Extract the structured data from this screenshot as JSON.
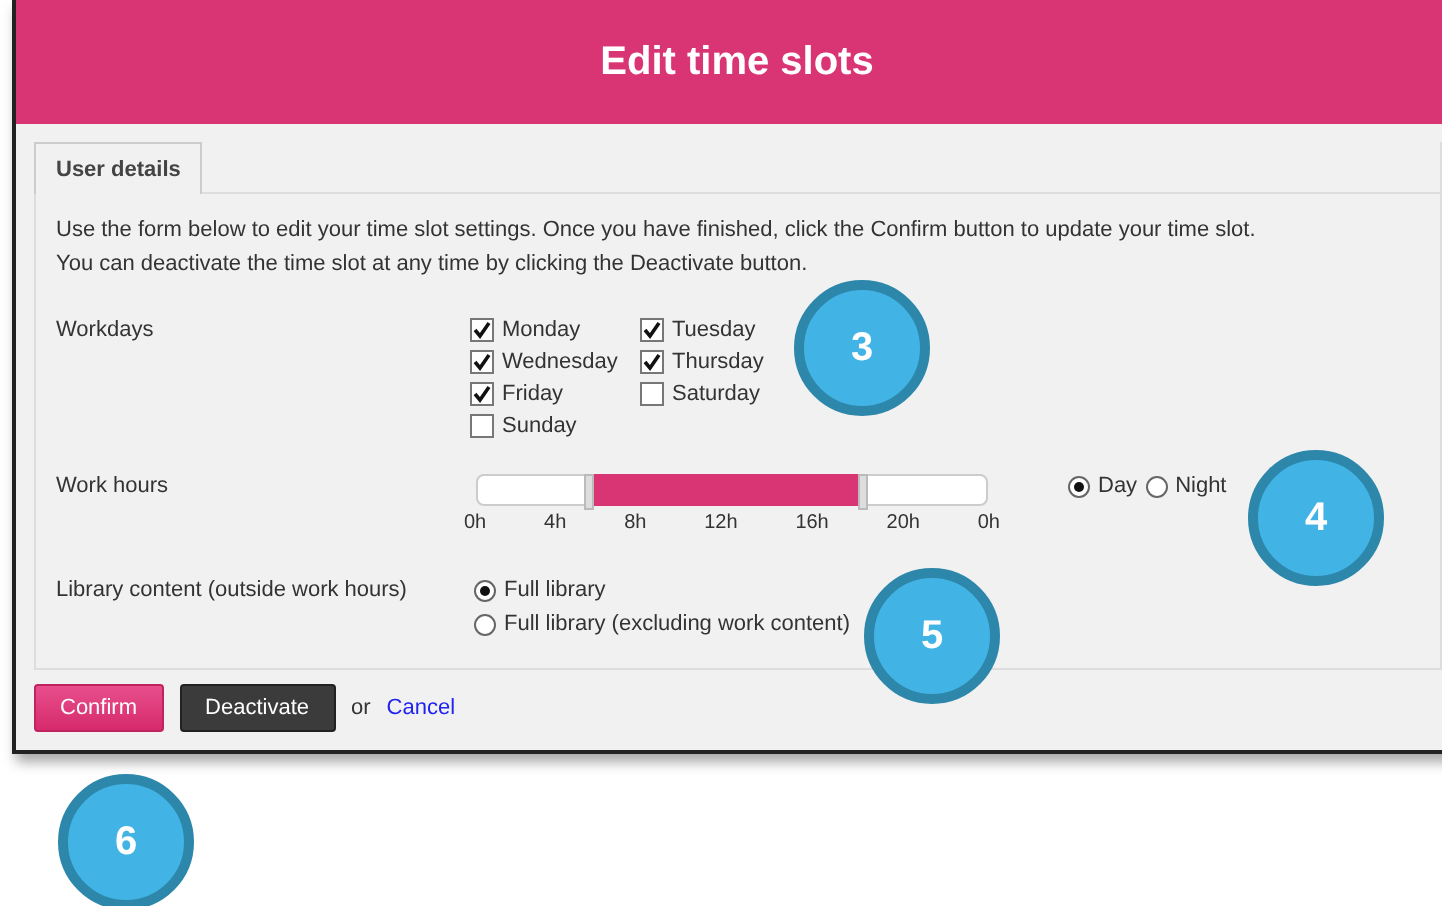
{
  "window": {
    "title": "Edit time slots"
  },
  "section": {
    "legend": "User details",
    "intro": "Use the form below to edit your time slot settings. Once you have finished, click the Confirm button to update your time slot. You can deactivate the time slot at any time by clicking the Deactivate button."
  },
  "workdays": {
    "label": "Workdays",
    "days": [
      {
        "label": "Monday",
        "checked": true
      },
      {
        "label": "Tuesday",
        "checked": true
      },
      {
        "label": "Wednesday",
        "checked": true
      },
      {
        "label": "Thursday",
        "checked": true
      },
      {
        "label": "Friday",
        "checked": true
      },
      {
        "label": "Saturday",
        "checked": false
      },
      {
        "label": "Sunday",
        "checked": false
      }
    ]
  },
  "work_hours": {
    "label": "Work hours",
    "handles": [
      {
        "level": 0.215
      },
      {
        "level": 0.755
      }
    ],
    "ticks": [
      "0h",
      "4h",
      "8h",
      "12h",
      "16h",
      "20h",
      "0h"
    ],
    "modes": [
      {
        "label": "Day",
        "selected": true
      },
      {
        "label": "Night",
        "selected": false
      }
    ]
  },
  "library": {
    "label": "Library content (outside work hours)",
    "options": [
      {
        "label": "Full library",
        "selected": true
      },
      {
        "label": "Full library (excluding work content)",
        "selected": false
      }
    ]
  },
  "actions": {
    "confirm": "Confirm",
    "deactivate": "Deactivate",
    "or": "or",
    "cancel": "Cancel"
  },
  "callouts": [
    "3",
    "4",
    "5",
    "6"
  ]
}
